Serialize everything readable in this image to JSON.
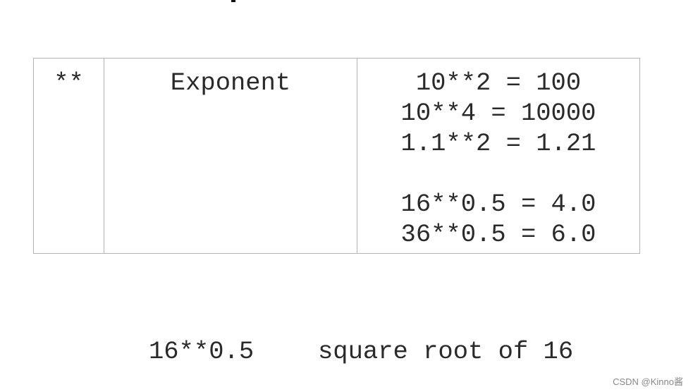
{
  "table": {
    "operator": "**",
    "name": "Exponent",
    "examples": [
      "10**2 = 100",
      "10**4 = 10000",
      "1.1**2 = 1.21",
      "",
      "16**0.5 = 4.0",
      "36**0.5 = 6.0"
    ]
  },
  "bottom": {
    "expression": "16**0.5",
    "description": "square root of 16"
  },
  "watermark": "CSDN @Kinno酱"
}
